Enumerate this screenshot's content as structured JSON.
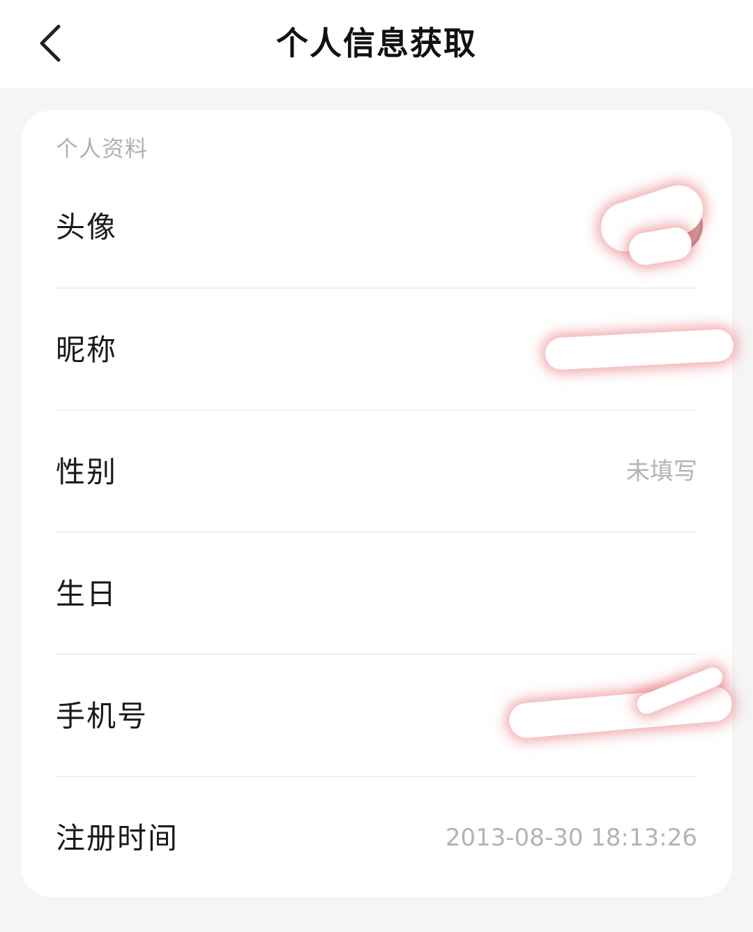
{
  "header": {
    "title": "个人信息获取",
    "back_icon": "chevron-left-icon"
  },
  "profile": {
    "section_label": "个人资料",
    "rows": [
      {
        "label": "头像",
        "value": ""
      },
      {
        "label": "昵称",
        "value": ""
      },
      {
        "label": "性别",
        "value": "未填写"
      },
      {
        "label": "生日",
        "value": ""
      },
      {
        "label": "手机号",
        "value": ""
      },
      {
        "label": "注册时间",
        "value": "2013-08-30 18:13:26"
      }
    ]
  },
  "colors": {
    "background": "#f5f5f5",
    "card": "#ffffff",
    "primary_text": "#1a1a1a",
    "secondary_text": "#b3b3b3"
  }
}
